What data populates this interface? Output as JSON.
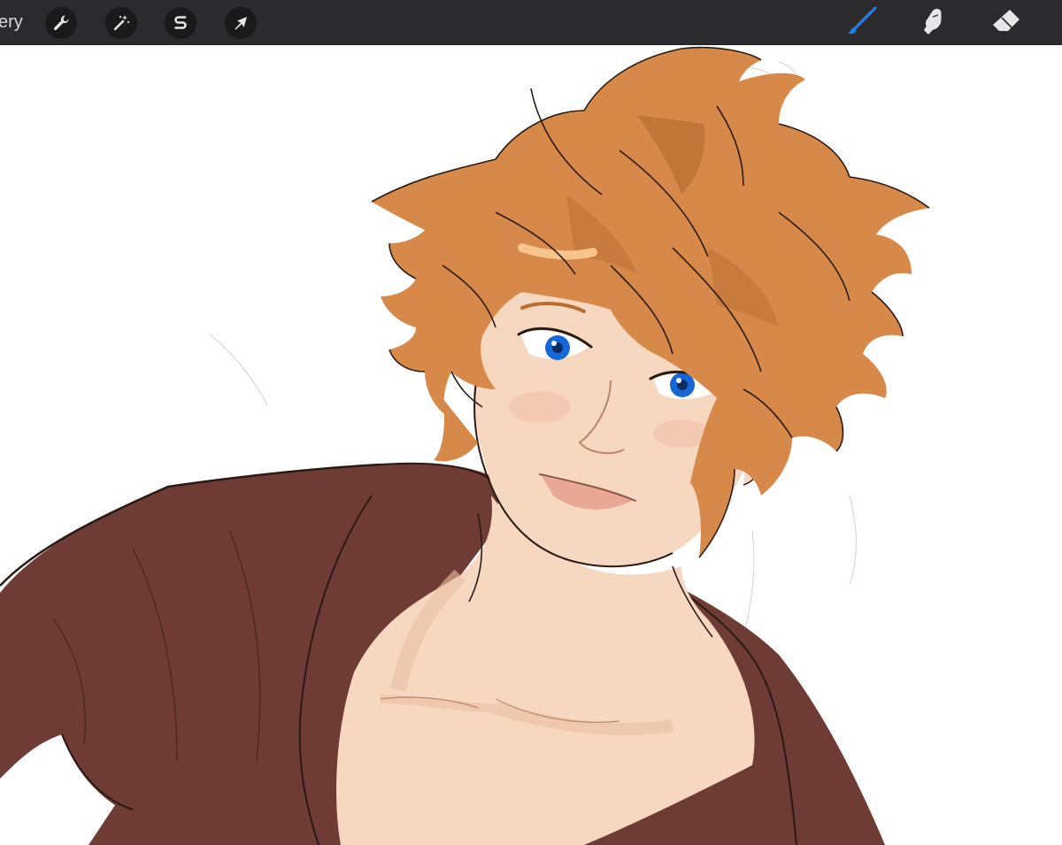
{
  "toolbar": {
    "gallery_label": "ery",
    "left_tools": [
      {
        "name": "actions",
        "icon": "wrench-icon"
      },
      {
        "name": "adjustments",
        "icon": "magic-wand-icon"
      },
      {
        "name": "selection",
        "icon": "selection-s-icon"
      },
      {
        "name": "transform",
        "icon": "arrow-cursor-icon"
      }
    ],
    "right_tools": [
      {
        "name": "brush",
        "icon": "brush-icon",
        "active": true
      },
      {
        "name": "smudge",
        "icon": "smudge-finger-icon",
        "active": false
      },
      {
        "name": "eraser",
        "icon": "eraser-icon",
        "active": false
      }
    ],
    "colors": {
      "bar": "#2b2b2d",
      "icon": "#e6e6e6",
      "active": "#1f7ff0"
    }
  },
  "canvas": {
    "background": "#ffffff",
    "artwork": {
      "colors": {
        "hair": "#d7894a",
        "hair_shadow": "#b86e32",
        "skin": "#f6d7c0",
        "skin_shadow": "#ebbfa2",
        "shirt": "#6f3c35",
        "eyes": "#1767d6",
        "lines": "#2a1a14"
      }
    }
  }
}
